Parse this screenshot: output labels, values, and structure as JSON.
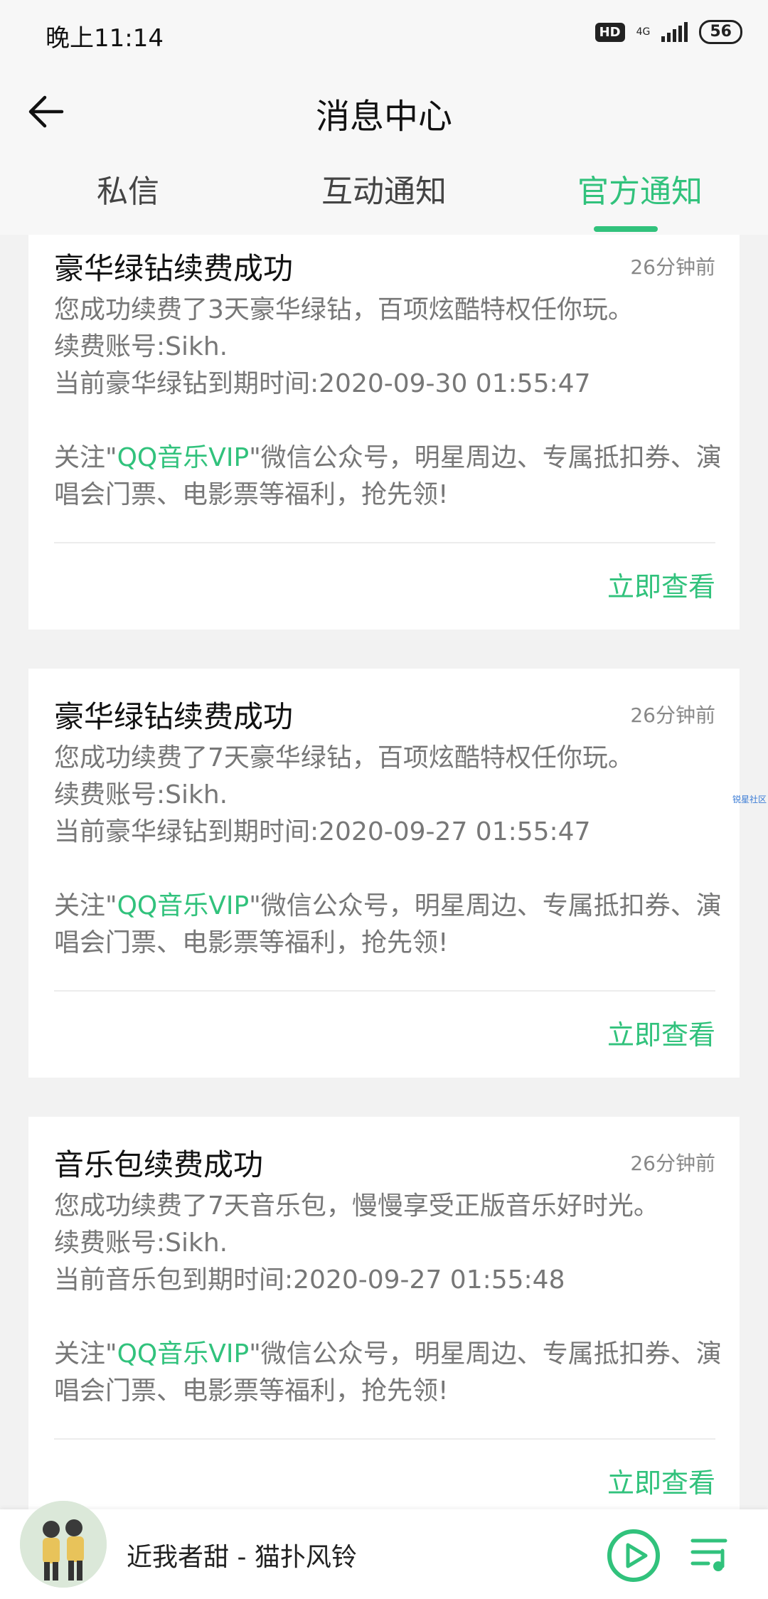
{
  "status_bar": {
    "time": "晚上11:14",
    "hd": "HD",
    "network": "4G",
    "battery": "56"
  },
  "header": {
    "title": "消息中心",
    "back_icon": "arrow-left-icon"
  },
  "tabs": [
    {
      "label": "私信",
      "active": false
    },
    {
      "label": "互动通知",
      "active": false
    },
    {
      "label": "官方通知",
      "active": true
    }
  ],
  "accent_color": "#31c27c",
  "cards": [
    {
      "title": "豪华绿钻续费成功",
      "time": "26分钟前",
      "line1": "您成功续费了3天豪华绿钻，百项炫酷特权任你玩。",
      "line2": "续费账号:Sikh.",
      "line3": "当前豪华绿钻到期时间:2020-09-30 01:55:47",
      "promo_prefix": "关注\"",
      "promo_highlight": "QQ音乐VIP",
      "promo_suffix": "\"微信公众号，明星周边、专属抵扣券、演唱会门票、电影票等福利，抢先领!",
      "action": "立即查看"
    },
    {
      "title": "豪华绿钻续费成功",
      "time": "26分钟前",
      "line1": "您成功续费了7天豪华绿钻，百项炫酷特权任你玩。",
      "line2": "续费账号:Sikh.",
      "line3": "当前豪华绿钻到期时间:2020-09-27 01:55:47",
      "promo_prefix": "关注\"",
      "promo_highlight": "QQ音乐VIP",
      "promo_suffix": "\"微信公众号，明星周边、专属抵扣券、演唱会门票、电影票等福利，抢先领!",
      "action": "立即查看"
    },
    {
      "title": "音乐包续费成功",
      "time": "26分钟前",
      "line1": "您成功续费了7天音乐包，慢慢享受正版音乐好时光。",
      "line2": "续费账号:Sikh.",
      "line3": "当前音乐包到期时间:2020-09-27 01:55:48",
      "promo_prefix": "关注\"",
      "promo_highlight": "QQ音乐VIP",
      "promo_suffix": "\"微信公众号，明星周边、专属抵扣券、演唱会门票、电影票等福利，抢先领!",
      "action": "立即查看"
    }
  ],
  "side_mark": "锐星社区",
  "player": {
    "song": "近我者甜 - 猫扑风铃",
    "play_icon": "play-circle-icon",
    "playlist_icon": "playlist-icon"
  }
}
